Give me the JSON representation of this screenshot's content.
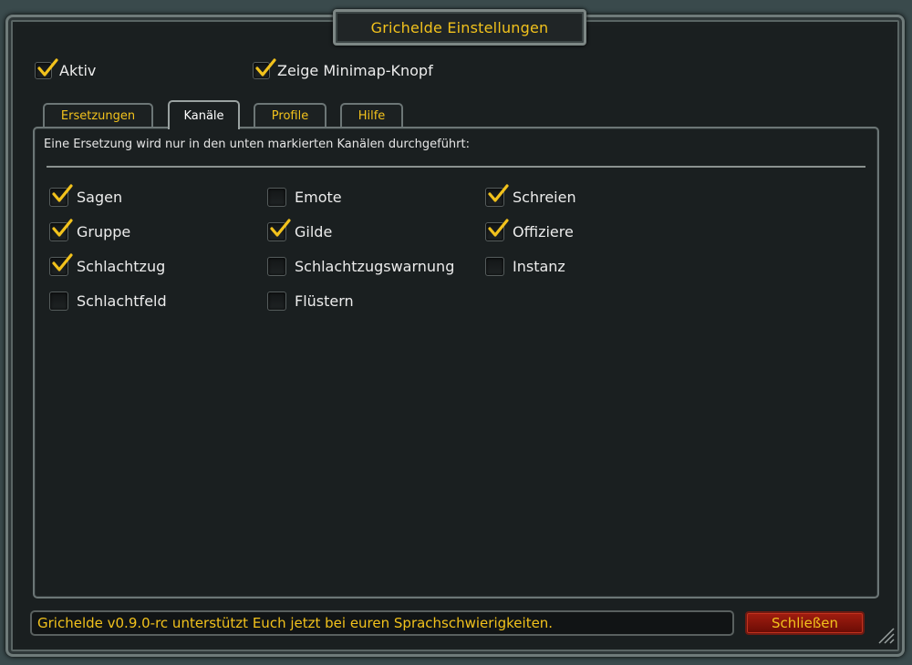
{
  "window": {
    "title": "Grichelde Einstellungen"
  },
  "top_options": [
    {
      "label": "Aktiv",
      "checked": true
    },
    {
      "label": "Zeige Minimap-Knopf",
      "checked": true
    }
  ],
  "tabs": [
    {
      "label": "Ersetzungen",
      "active": false
    },
    {
      "label": "Kanäle",
      "active": true
    },
    {
      "label": "Profile",
      "active": false
    },
    {
      "label": "Hilfe",
      "active": false
    }
  ],
  "panel": {
    "description": "Eine Ersetzung wird nur in den unten markierten Kanälen durchgeführt:",
    "channels": [
      {
        "label": "Sagen",
        "checked": true
      },
      {
        "label": "Emote",
        "checked": false
      },
      {
        "label": "Schreien",
        "checked": true
      },
      {
        "label": "Gruppe",
        "checked": true
      },
      {
        "label": "Gilde",
        "checked": true
      },
      {
        "label": "Offiziere",
        "checked": true
      },
      {
        "label": "Schlachtzug",
        "checked": true
      },
      {
        "label": "Schlachtzugswarnung",
        "checked": false
      },
      {
        "label": "Instanz",
        "checked": false
      },
      {
        "label": "Schlachtfeld",
        "checked": false
      },
      {
        "label": "Flüstern",
        "checked": false
      }
    ]
  },
  "status": {
    "text": "Grichelde v0.9.0-rc unterstützt Euch jetzt bei euren Sprachschwierigkeiten."
  },
  "buttons": {
    "close_label": "Schließen"
  },
  "colors": {
    "gold": "#f2c21c",
    "checkmark": "#f2c21c",
    "close_button": "#a11d10"
  },
  "icons": {
    "check": "checkmark-icon",
    "resize": "resize-grip-icon"
  }
}
